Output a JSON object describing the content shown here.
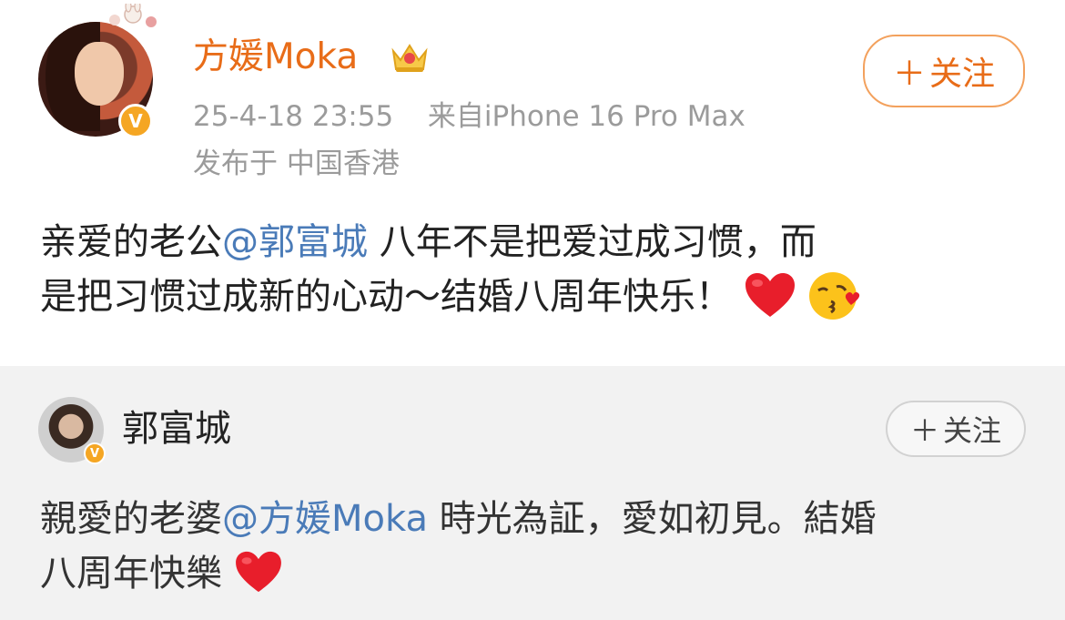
{
  "post": {
    "username": "方媛Moka",
    "timestamp": "25-4-18 23:55",
    "source": "来自iPhone 16 Pro Max",
    "location": "发布于 中国香港",
    "follow_label": "关注",
    "text_line1_before": "亲爱的老公",
    "mention": "@郭富城",
    "text_line1_after": " 八年不是把爱过成习惯，而",
    "text_line2": "是把习惯过成新的心动～结婚八周年快乐！",
    "verified_badge": "V"
  },
  "repost": {
    "username": "郭富城",
    "follow_label": "关注",
    "text_line1_before": "親愛的老婆",
    "mention": "@方媛Moka",
    "text_line1_after": " 時光為証，愛如初見。結婚",
    "text_line2": "八周年快樂",
    "verified_badge": "V"
  },
  "colors": {
    "accent_orange": "#e86c18",
    "mention_blue": "#4a7bb8",
    "meta_gray": "#9b9b9b",
    "repost_bg": "#f2f2f2",
    "verified_yellow": "#f5a623"
  },
  "icons": [
    "crown-icon",
    "plus-icon",
    "heart-emoji-icon",
    "kiss-emoji-icon",
    "verified-icon"
  ]
}
